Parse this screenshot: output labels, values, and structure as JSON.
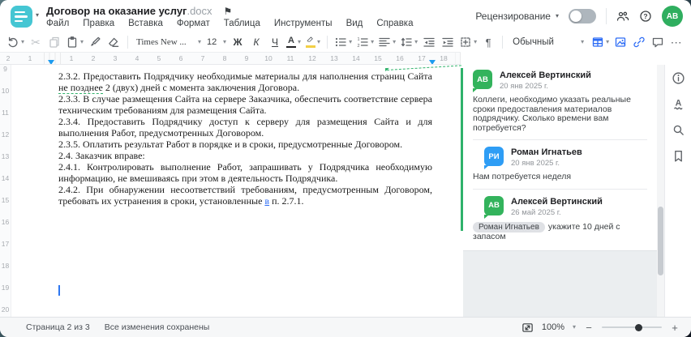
{
  "window": {
    "title": "Договор на оказание услуг",
    "title_ext": ".docx"
  },
  "menu": {
    "items": [
      "Файл",
      "Правка",
      "Вставка",
      "Формат",
      "Таблица",
      "Инструменты",
      "Вид",
      "Справка"
    ]
  },
  "header_right": {
    "review_label": "Рецензирование",
    "avatar_initials": "АВ"
  },
  "toolbar": {
    "font_name": "Times New ...",
    "font_size": "12",
    "bold_label": "Ж",
    "italic_label": "К",
    "underline_label": "Ч",
    "font_color_letter": "А",
    "style_name": "Обычный"
  },
  "icons": {
    "caret": "▾",
    "flag": "⚑",
    "cut": "✂",
    "pilcrow": "¶",
    "more": "⋯",
    "minus": "−",
    "plus": "+"
  },
  "hruler": {
    "left_numbers": [
      "2",
      "1"
    ],
    "numbers": [
      "1",
      "2",
      "3",
      "4",
      "5",
      "6",
      "7",
      "8",
      "9",
      "10",
      "11",
      "12",
      "13",
      "14",
      "15",
      "16",
      "17",
      "18"
    ]
  },
  "vruler": {
    "numbers": [
      "9",
      "10",
      "11",
      "12",
      "13",
      "14",
      "15",
      "16",
      "17",
      "18",
      "19",
      "20"
    ]
  },
  "document": {
    "p1": {
      "pre": "2.3.2. Предоставить Подрядчику необходимые материалы для наполнения страниц Сайта ",
      "anchor": "не позднее",
      "post": " 2 (двух) дней с момента заключения Договора."
    },
    "p2": "2.3.3. В случае размещения Сайта на сервере Заказчика, обеспечить соответствие сервера техническим требованиям для размещения Сайта.",
    "p3": "2.3.4. Предоставить Подрядчику доступ к серверу для размещения Сайта и для выполнения Работ, предусмотренных Договором.",
    "p4": "2.3.5. Оплатить результат Работ в порядке и в сроки, предусмотренные Договором.",
    "p5": "2.4. Заказчик вправе:",
    "p6": "2.4.1. Контролировать выполнение Работ, запрашивать у Подрядчика необходимую информацию, не вмешиваясь при этом в деятельность Подрядчика.",
    "p7": {
      "pre": "2.4.2. При обнаружении несоответствий требованиям, предусмотренным Договором, требовать их устранения в сроки, установленные ",
      "link": "в",
      "post": " п. 2.7.1."
    }
  },
  "comments": {
    "thread": [
      {
        "initials": "АВ",
        "name": "Алексей Вертинский",
        "date": "20 янв 2025 г.",
        "text": "Коллеги, необходимо указать реальные сроки предоставления материалов подрядчику. Сколько времени вам потребуется?"
      },
      {
        "initials": "РИ",
        "name": "Роман Игнатьев",
        "date": "20 янв 2025 г.",
        "text": "Нам потребуется неделя"
      },
      {
        "initials": "АВ",
        "name": "Алексей Вертинский",
        "date": "26 май 2025 г.",
        "mention": "Роман Игнатьев",
        "text": "укажите 10 дней с запасом"
      }
    ]
  },
  "statusbar": {
    "page_info": "Страница 2 из 3",
    "saved_info": "Все изменения сохранены",
    "zoom_level": "100%"
  },
  "colors": {
    "logo_teal": "#45c6d3",
    "accent_blue": "#2d6cf5",
    "comment_green": "#2fb26b",
    "avatar_green": "#33b35c",
    "avatar_blue": "#2e9df5",
    "ruler_marker_blue": "#1c9bef",
    "highlight_yellow": "#f3cf45"
  }
}
